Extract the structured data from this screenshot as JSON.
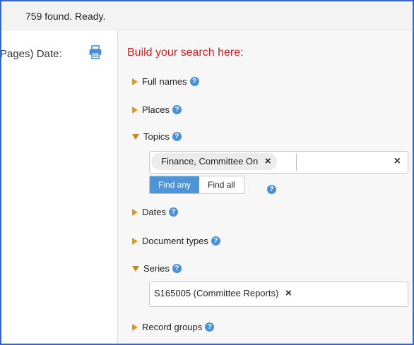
{
  "status": {
    "text": "759 found. Ready."
  },
  "left_panel": {
    "label": "(Pages) Date:",
    "print_icon": "printer-icon"
  },
  "search": {
    "title": "Build your search here:",
    "help_glyph": "?",
    "sections": {
      "full_names": "Full names",
      "places": "Places",
      "topics": "Topics",
      "dates": "Dates",
      "document_types": "Document types",
      "series": "Series",
      "record_groups": "Record groups"
    },
    "topics_field": {
      "chip": "Finance, Committee On",
      "remove_glyph": "×",
      "clear_glyph": "×",
      "input_value": ""
    },
    "match_toggle": {
      "any": "Find any",
      "all": "Find all",
      "selected": "any"
    },
    "series_field": {
      "chip": "S165005 (Committee Reports)",
      "remove_glyph": "×"
    }
  },
  "colors": {
    "title": "#e0161c",
    "triangle": "#e09a1a",
    "help": "#4a90d9",
    "active_toggle": "#4f94d4",
    "frame_border": "#3366cc"
  }
}
